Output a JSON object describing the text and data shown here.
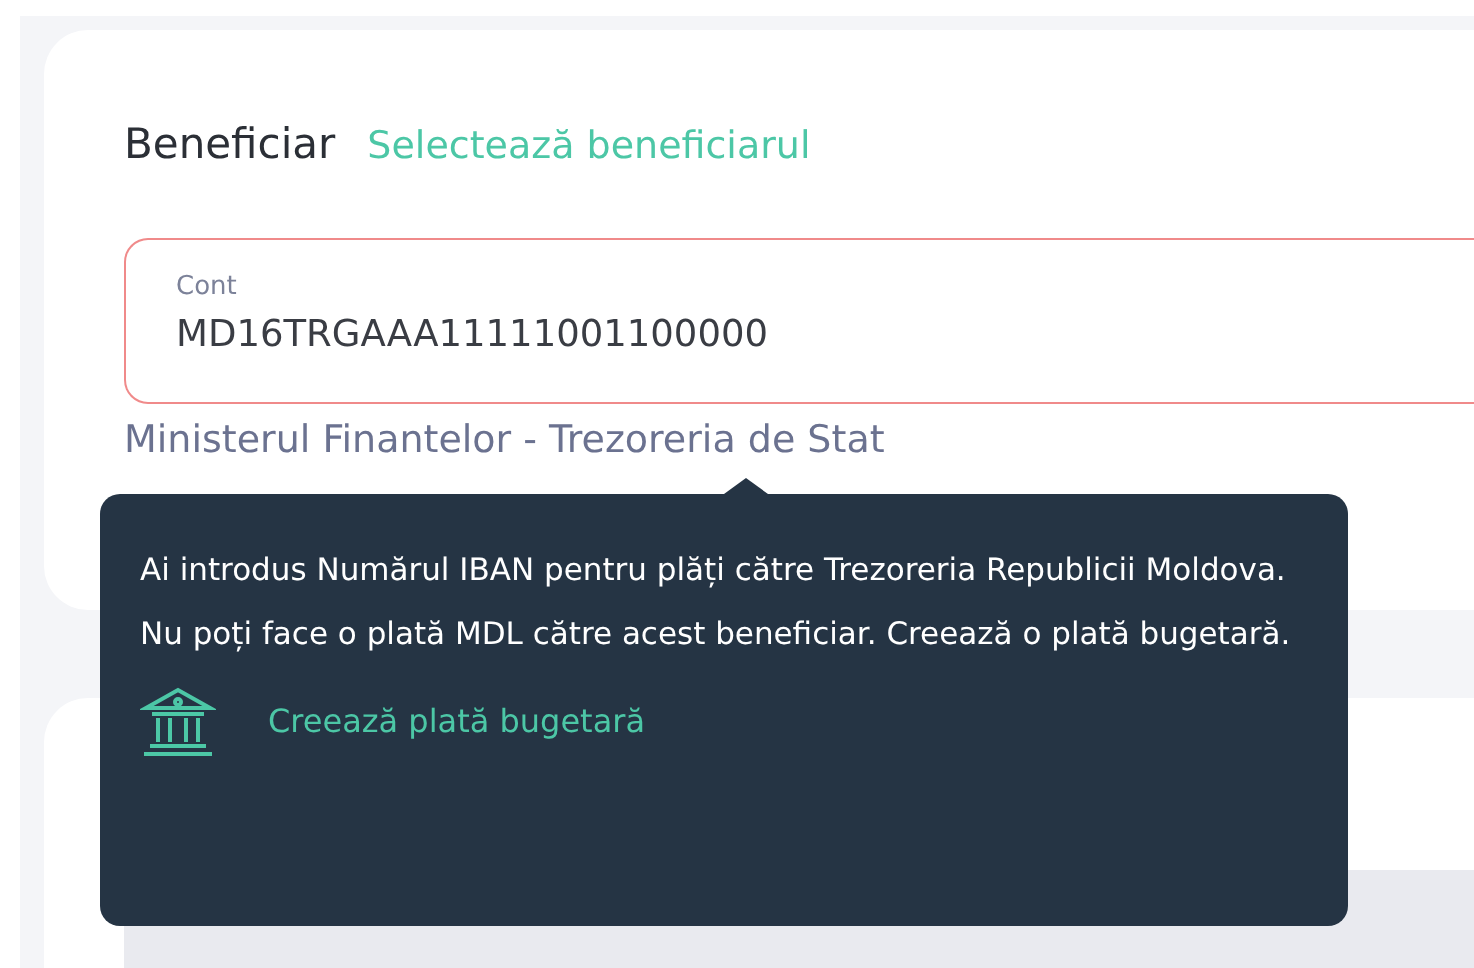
{
  "beneficiary": {
    "title": "Beneficiar",
    "select_link": "Selectează beneficiarul"
  },
  "account_field": {
    "label": "Cont",
    "value": "MD16TRGAAA11111001100000",
    "error": true
  },
  "account_owner": "Ministerul Finantelor - Trezoreria de Stat",
  "tooltip": {
    "message": "Ai introdus Numărul IBAN pentru plăți către Trezoreria Republicii Moldova. Nu poți face o plată MDL către acest beneficiar. Creează o plată bugetară.",
    "action": "Creează plată bugetară"
  }
}
